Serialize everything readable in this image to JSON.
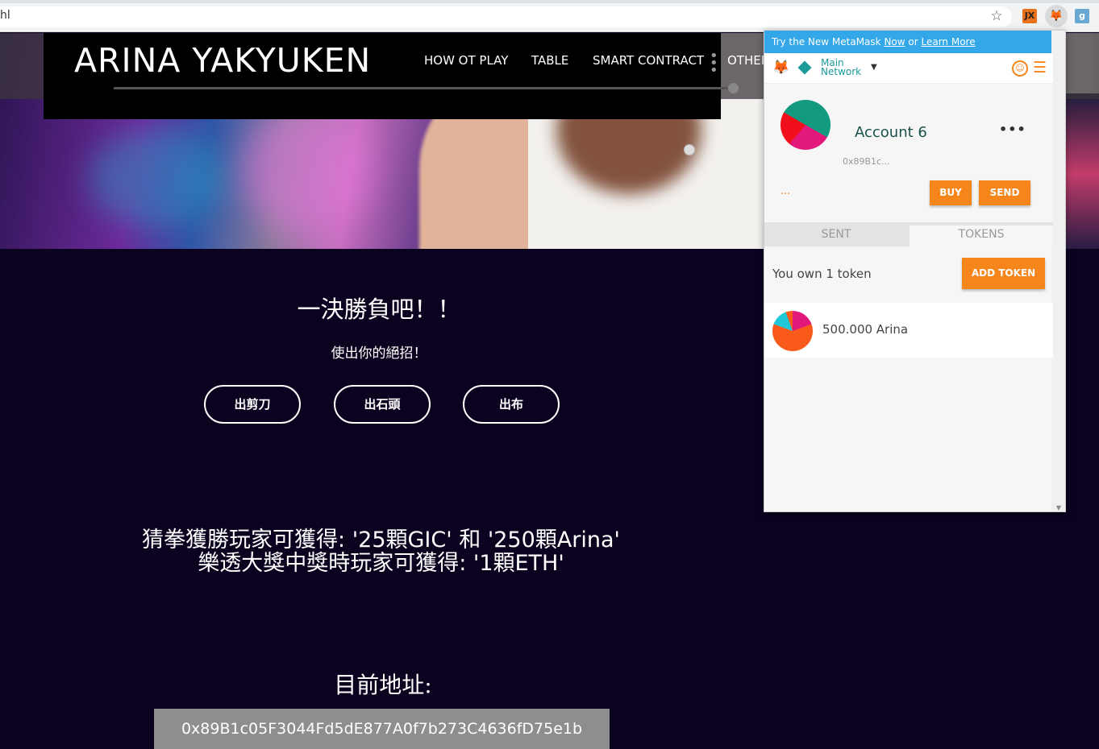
{
  "browser": {
    "url_fragment": "hl",
    "bookmark_icon": "star-icon",
    "extensions": [
      {
        "name": "jx-extension-icon",
        "label": "JX"
      },
      {
        "name": "metamask-fox-icon",
        "label": "🦊"
      },
      {
        "name": "third-extension-icon",
        "label": "g"
      }
    ]
  },
  "site": {
    "brand": "ARINA YAKYUKEN",
    "nav": {
      "how_to_play": "HOW OT PLAY",
      "table": "TABLE",
      "smart_contract": "SMART CONTRACT",
      "others": "OTHERS"
    }
  },
  "game": {
    "title": "一決勝負吧！！",
    "subtitle": "使出你的絕招！",
    "buttons": {
      "scissors": "出剪刀",
      "rock": "出石頭",
      "paper": "出布"
    },
    "prize_line1": "猜拳獲勝玩家可獲得: '25顆GIC' 和 '250顆Arina'",
    "prize_line2": "樂透大獎中獎時玩家可獲得: '1顆ETH'",
    "address_title": "目前地址:",
    "address": "0x89B1c05F3044Fd5dE877A0f7b273C4636fD75e1b"
  },
  "metamask": {
    "banner_prefix": "Try the New MetaMask ",
    "banner_now": "Now",
    "banner_mid": " or ",
    "banner_learn": "Learn More",
    "network_line1": "Main",
    "network_line2": "Network",
    "account_name": "Account 6",
    "account_address": "0x89B1c...",
    "balance": "...",
    "more": "•••",
    "buy": "BUY",
    "send": "SEND",
    "tab_sent": "SENT",
    "tab_tokens": "TOKENS",
    "own_text": "You own 1 token",
    "add_token": "ADD TOKEN",
    "token_amount": "500.000 Arina",
    "colors": {
      "accent": "#f6851b",
      "teal": "#1b9a9a",
      "banner": "#34a7e8"
    }
  }
}
